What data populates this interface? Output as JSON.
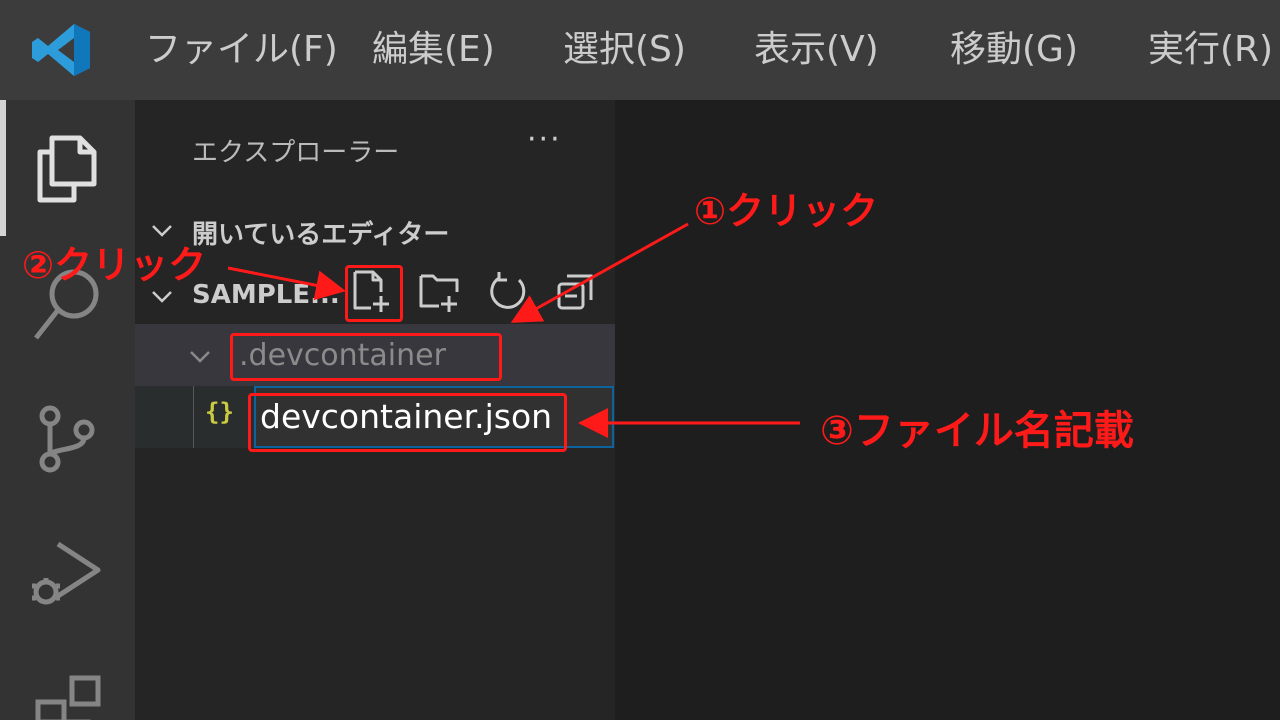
{
  "menubar": {
    "items": [
      "ファイル(F)",
      "編集(E)",
      "選択(S)",
      "表示(V)",
      "移動(G)",
      "実行(R)"
    ]
  },
  "sidebar": {
    "title": "エクスプローラー",
    "more": "···",
    "open_editors": "開いているエディター",
    "folder": "SAMPLE...",
    "tree": {
      "folder_name": ".devcontainer",
      "file_icon": "{}",
      "new_file_name": "devcontainer.json"
    }
  },
  "annotations": {
    "step1": "①クリック",
    "step2": "②クリック",
    "step3": "③ファイル名記載"
  },
  "icons": {
    "activity": [
      "explorer-icon",
      "search-icon",
      "source-control-icon",
      "run-debug-icon",
      "extensions-icon"
    ],
    "toolbar": [
      "new-file-icon",
      "new-folder-icon",
      "refresh-icon",
      "collapse-all-icon"
    ]
  },
  "colors": {
    "accent": "#007acc",
    "annotation": "#ff1a1a",
    "json_icon": "#cbcb41"
  }
}
